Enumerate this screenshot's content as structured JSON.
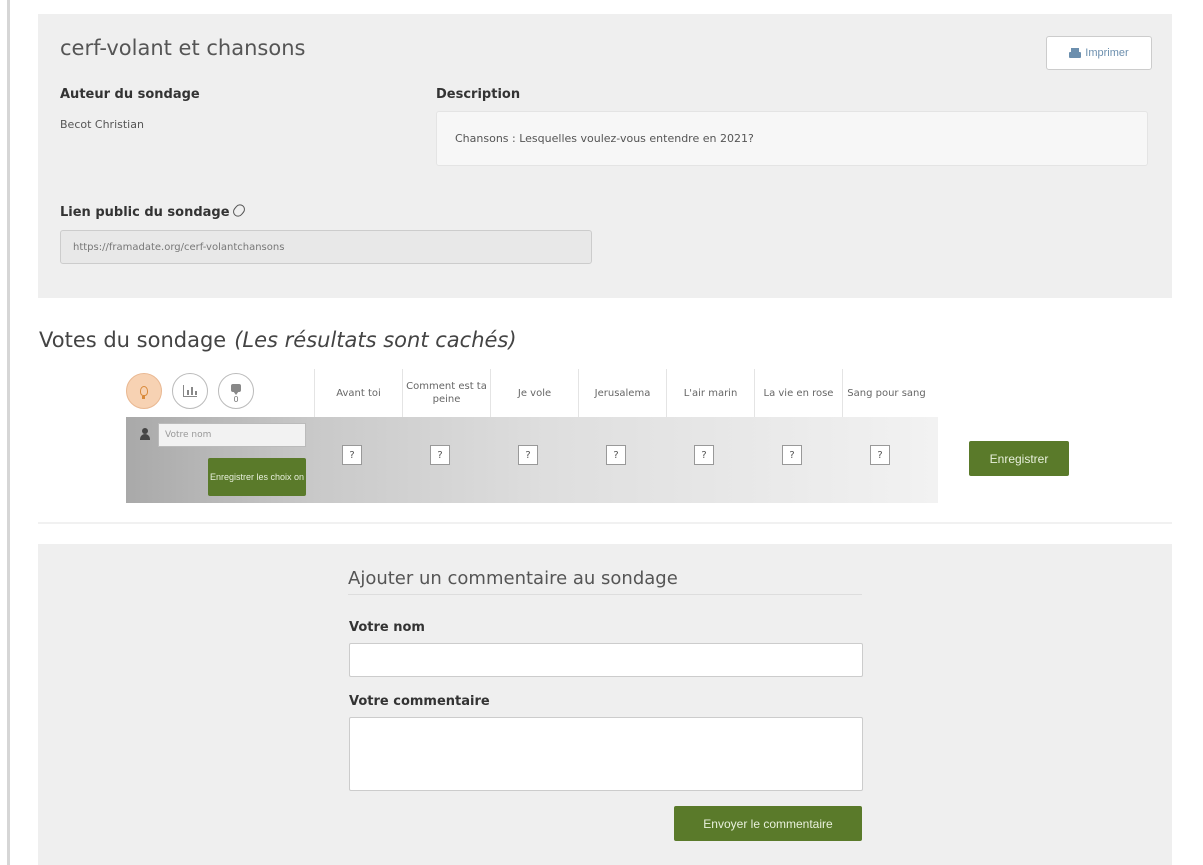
{
  "poll": {
    "title": "cerf-volant et chansons",
    "print_label": "Imprimer",
    "author_label": "Auteur du sondage",
    "author": "Becot Christian",
    "description_label": "Description",
    "description": "Chansons :  Lesquelles voulez-vous entendre en 2021?",
    "public_link_label": "Lien public du sondage",
    "public_link": "https://framadate.org/cerf-volantchansons"
  },
  "votes": {
    "heading": "Votes du sondage",
    "hidden_note": "(Les résultats sont cachés)",
    "comment_count": "0",
    "columns": [
      "Avant toi",
      "Comment est ta peine",
      "Je vole",
      "Jerusalema",
      "L'air marin",
      "La vie en rose",
      "Sang pour sang"
    ],
    "unknown_mark": "?",
    "name_placeholder": "Votre nom",
    "save_choices_label": "Enregistrer les choix on",
    "save_label": "Enregistrer"
  },
  "comment": {
    "heading": "Ajouter un commentaire au sondage",
    "name_label": "Votre nom",
    "comment_label": "Votre commentaire",
    "send_label": "Envoyer le commentaire"
  },
  "colors": {
    "primary_green": "#5a7a2a",
    "panel_gray": "#efefef",
    "active_icon": "#f7d2b3"
  }
}
